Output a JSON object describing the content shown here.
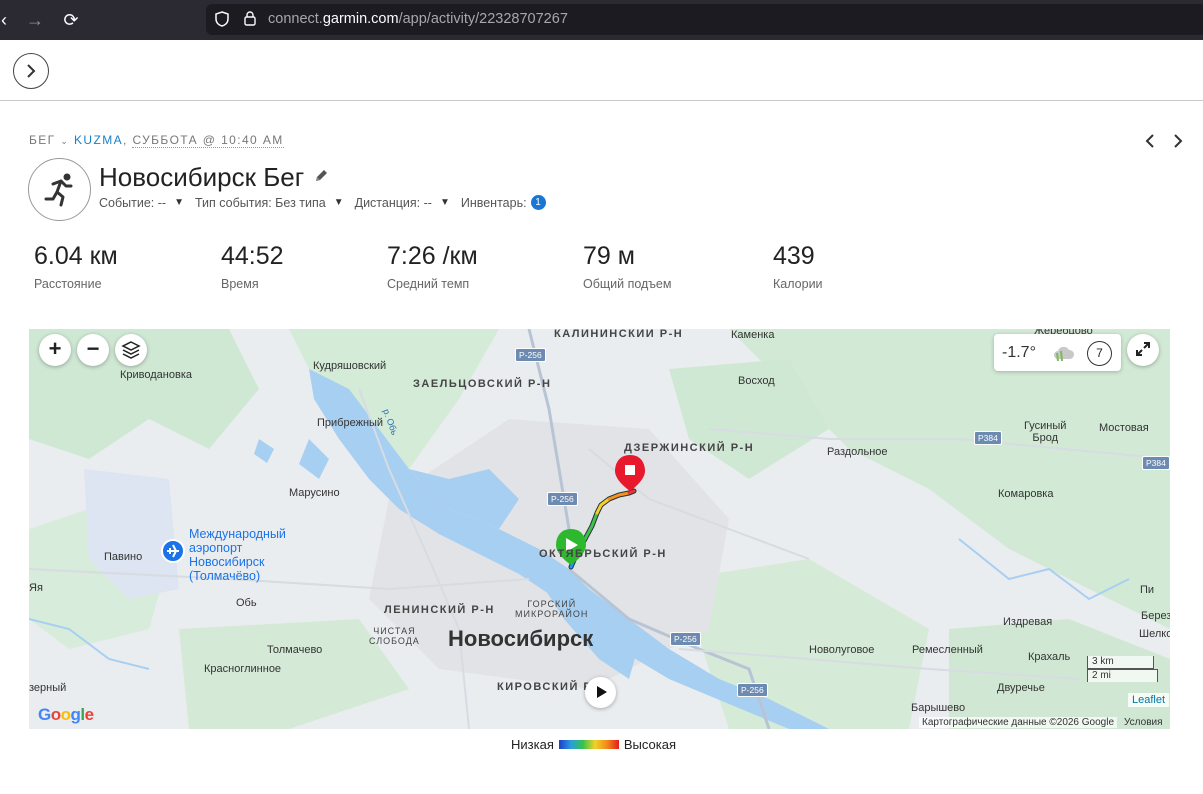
{
  "browser": {
    "url_prefix": "connect.",
    "url_host": "garmin.com",
    "url_path": "/app/activity/22328707267"
  },
  "breadcrumb": {
    "type": "БЕГ",
    "user": "KUZMA",
    "separator": ",",
    "date": "СУББОТА @ 10:40 AM"
  },
  "activity": {
    "title": "Новосибирск Бег",
    "meta": [
      {
        "label": "Событие: --"
      },
      {
        "label": "Тип события: Без типа"
      },
      {
        "label": "Дистанция: --"
      }
    ],
    "gear_label": "Инвентарь:",
    "gear_count": "1"
  },
  "stats": [
    {
      "value": "6.04 км",
      "label": "Расстояние"
    },
    {
      "value": "44:52",
      "label": "Время"
    },
    {
      "value": "7:26 /км",
      "label": "Средний темп"
    },
    {
      "value": "79 м",
      "label": "Общий подъем"
    },
    {
      "value": "439",
      "label": "Калории"
    }
  ],
  "map": {
    "zoom_in": "+",
    "zoom_out": "−",
    "weather_temp": "-1.7°",
    "wind_speed": "7",
    "labels": {
      "kalininsky": "КАЛИНИНСКИЙ Р-Н",
      "kamenka": "Каменка",
      "zhereshchovo": "Жеребцово",
      "krivodanovka": "Криводановка",
      "kudryashovsky": "Кудряшовский",
      "zaeltsovsky": "ЗАЕЛЬЦОВСКИЙ Р-Н",
      "voskhod": "Восход",
      "ob_river": "р. Обь",
      "pribrezhny": "Прибрежный",
      "dzerzhinsky": "ДЗЕРЖИНСКИЙ Р-Н",
      "razdolnoe": "Раздольное",
      "gusiny_brod": "Гусиный\nБрод",
      "mostovaya": "Мостовая",
      "marusino": "Марусино",
      "komarovka": "Комаровка",
      "airport": "Международный\nаэропорт\nНовосибирск\n(Толмачёво)",
      "pavino": "Павино",
      "oktyabrsky": "ОКТЯБРЬСКИЙ Р-Н",
      "yaya": "Яя",
      "ob_town": "Обь",
      "leninsky": "ЛЕНИНСКИЙ Р-Н",
      "gorsky": "ГОРСКИЙ\nМИКРОРАЙОН",
      "chistaya": "ЧИСТАЯ\nСЛОБОДА",
      "novosibirsk": "Новосибирск",
      "berezovka": "Берез",
      "izdrevaya": "Издревая",
      "shelkovo": "Шелков",
      "tolmachevo": "Толмачево",
      "novolugovoe": "Новолуговое",
      "remeslenny": "Ремесленный",
      "krakhal": "Крахаль",
      "krasnoglinnoe": "Красноглинное",
      "dvurechye": "Двуречье",
      "ozerny": "зерный",
      "kirovsky": "КИРОВСКИЙ Р-Н",
      "baryshevo": "Барышево",
      "pi": "Пи"
    },
    "road_signs": [
      "Р-256",
      "Р-256",
      "Р-256",
      "Р-256",
      "Р384",
      "Р384"
    ],
    "scale_km": "3 km",
    "scale_mi": "2 mi",
    "leaflet": "Leaflet",
    "attribution": "Картографические данные ©2026 Google",
    "terms": "Условия",
    "google_logo": "Google"
  },
  "legend": {
    "low": "Низкая",
    "high": "Высокая"
  }
}
